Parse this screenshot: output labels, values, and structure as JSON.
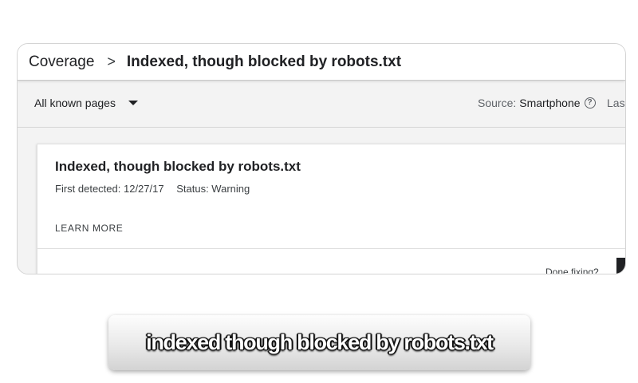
{
  "breadcrumb": {
    "parent": "Coverage",
    "separator": ">",
    "current": "Indexed, though blocked by robots.txt"
  },
  "toolbar": {
    "filter_label": "All known pages",
    "source_label": "Source:",
    "source_value": "Smartphone",
    "help_icon": "?",
    "truncated_label": "Las"
  },
  "issue": {
    "title": "Indexed, though blocked by robots.txt",
    "first_detected": "First detected: 12/27/17",
    "status": "Status: Warning",
    "learn_more": "LEARN MORE",
    "done_fixing": "Done fixing?"
  },
  "caption": {
    "text": "indexed though blocked by robots.txt"
  }
}
